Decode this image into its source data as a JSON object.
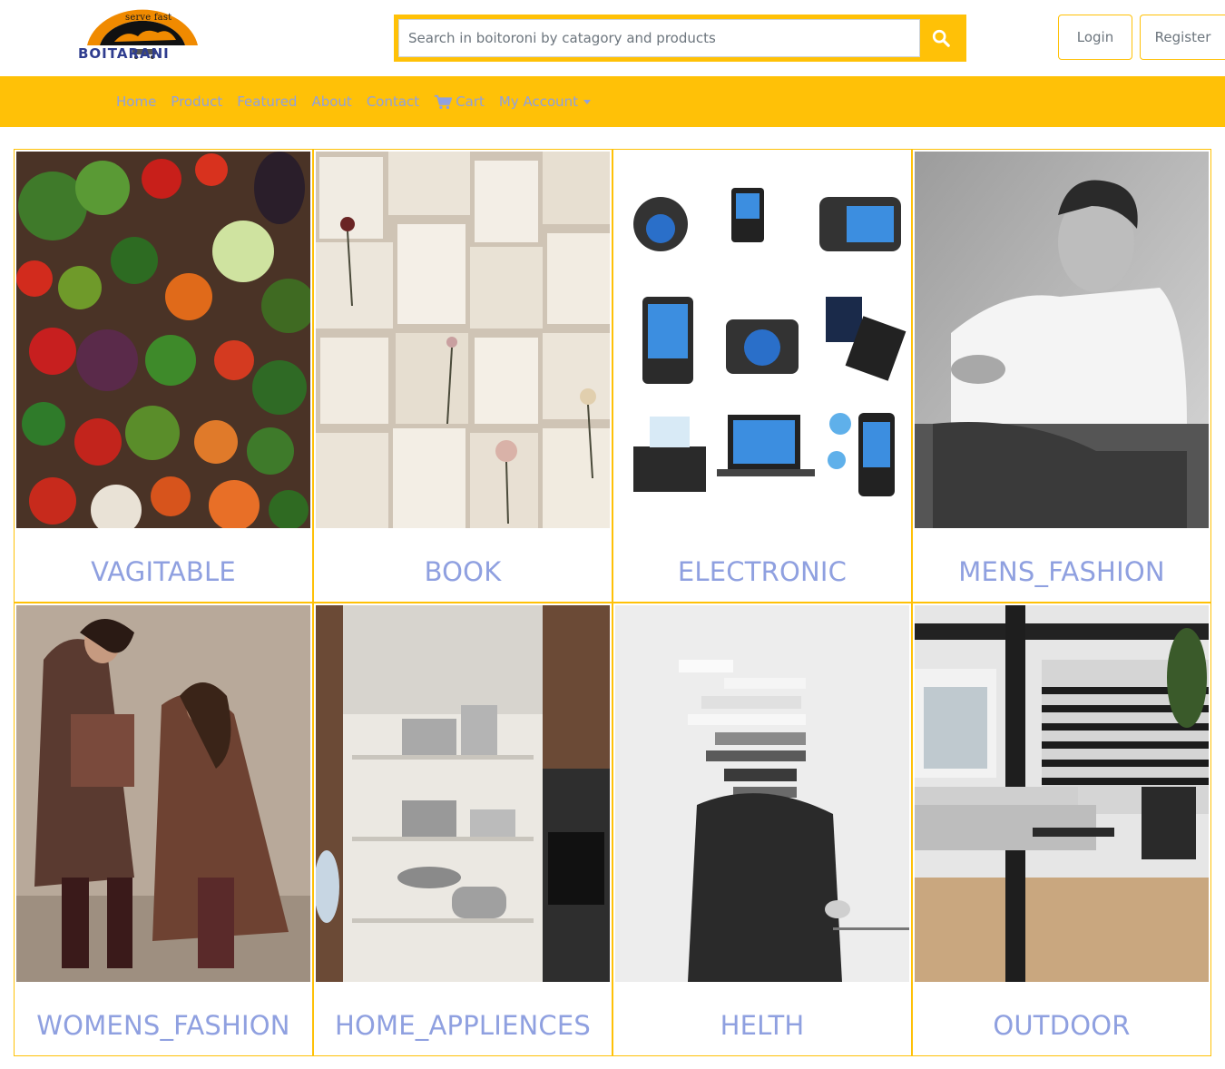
{
  "header": {
    "logo": {
      "tagline": "serve fast",
      "brand": "BOITARANI"
    },
    "search": {
      "placeholder": "Search in boitoroni by catagory and products",
      "value": ""
    },
    "search_icon": "search-icon",
    "auth": {
      "login_label": "Login",
      "register_label": "Register"
    }
  },
  "nav": {
    "items": [
      {
        "label": "Home"
      },
      {
        "label": "Product"
      },
      {
        "label": "Featured"
      },
      {
        "label": "About"
      },
      {
        "label": "Contact"
      },
      {
        "label": "Cart",
        "icon": "cart-icon"
      },
      {
        "label": "My Account",
        "dropdown": true
      }
    ]
  },
  "categories": [
    {
      "title": "VAGITABLE",
      "image": "vegetables-photo"
    },
    {
      "title": "BOOK",
      "image": "books-photo"
    },
    {
      "title": "ELECTRONIC",
      "image": "electronics-photo"
    },
    {
      "title": "MENS_FASHION",
      "image": "mens-fashion-photo"
    },
    {
      "title": "WOMENS_FASHION",
      "image": "womens-fashion-photo"
    },
    {
      "title": "HOME_APPLIENCES",
      "image": "home-appliances-photo"
    },
    {
      "title": "HELTH",
      "image": "health-photo"
    },
    {
      "title": "OUTDOOR",
      "image": "outdoor-photo"
    }
  ],
  "colors": {
    "accent": "#ffc107",
    "link": "#8fa0e0",
    "brand": "#2f3d8f"
  }
}
